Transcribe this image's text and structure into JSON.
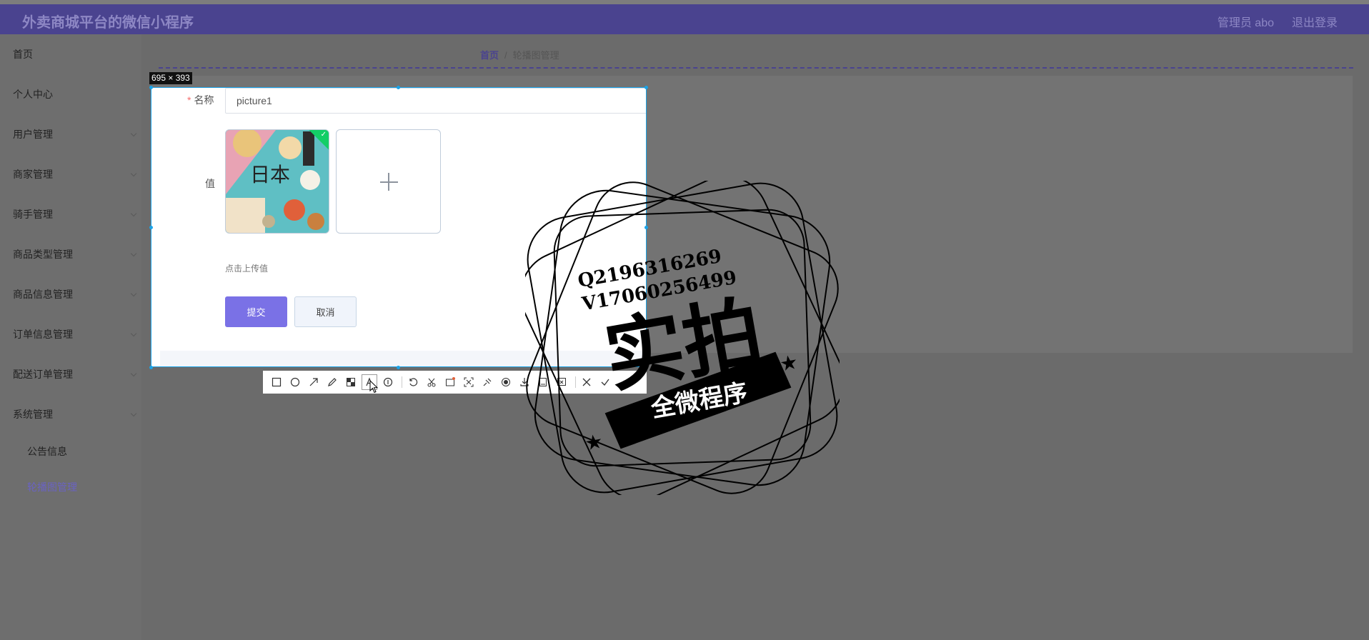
{
  "header": {
    "app_title": "外卖商城平台的微信小程序",
    "user_label": "管理员 abo",
    "logout_label": "退出登录"
  },
  "sidebar": {
    "items": [
      {
        "label": "首页"
      },
      {
        "label": "个人中心"
      },
      {
        "label": "用户管理"
      },
      {
        "label": "商家管理"
      },
      {
        "label": "骑手管理"
      },
      {
        "label": "商品类型管理"
      },
      {
        "label": "商品信息管理"
      },
      {
        "label": "订单信息管理"
      },
      {
        "label": "配送订单管理"
      },
      {
        "label": "系统管理"
      }
    ],
    "sub_items": [
      {
        "label": "公告信息"
      },
      {
        "label": "轮播图管理"
      }
    ]
  },
  "breadcrumb": {
    "home": "首页",
    "separator": "/",
    "current": "轮播图管理"
  },
  "capture": {
    "size_label": "695 × 393"
  },
  "form": {
    "name_label": "名称",
    "required_mark": "*",
    "name_value": "picture1",
    "value_label": "值",
    "thumbnail_text": "日本",
    "upload_hint": "点击上传值",
    "submit_label": "提交",
    "cancel_label": "取消"
  },
  "toolbar": {
    "tools": [
      "rectangle-icon",
      "ellipse-icon",
      "arrow-icon",
      "pencil-icon",
      "mosaic-icon",
      "text-icon",
      "number-icon",
      "undo-icon",
      "scissors-icon",
      "ocr-icon",
      "scan-icon",
      "pin-icon",
      "record-icon",
      "download-icon",
      "save-icon",
      "bookmark-icon",
      "close-icon",
      "confirm-icon"
    ]
  },
  "watermark": {
    "line1": "Q2196316269",
    "line2": "V17060256499",
    "big_text": "实拍",
    "banner_text": "全微程序"
  },
  "colors": {
    "header_bg": "#4a438f",
    "accent": "#7a71e6",
    "selection_border": "#1aa3e8",
    "success": "#13ce66"
  }
}
